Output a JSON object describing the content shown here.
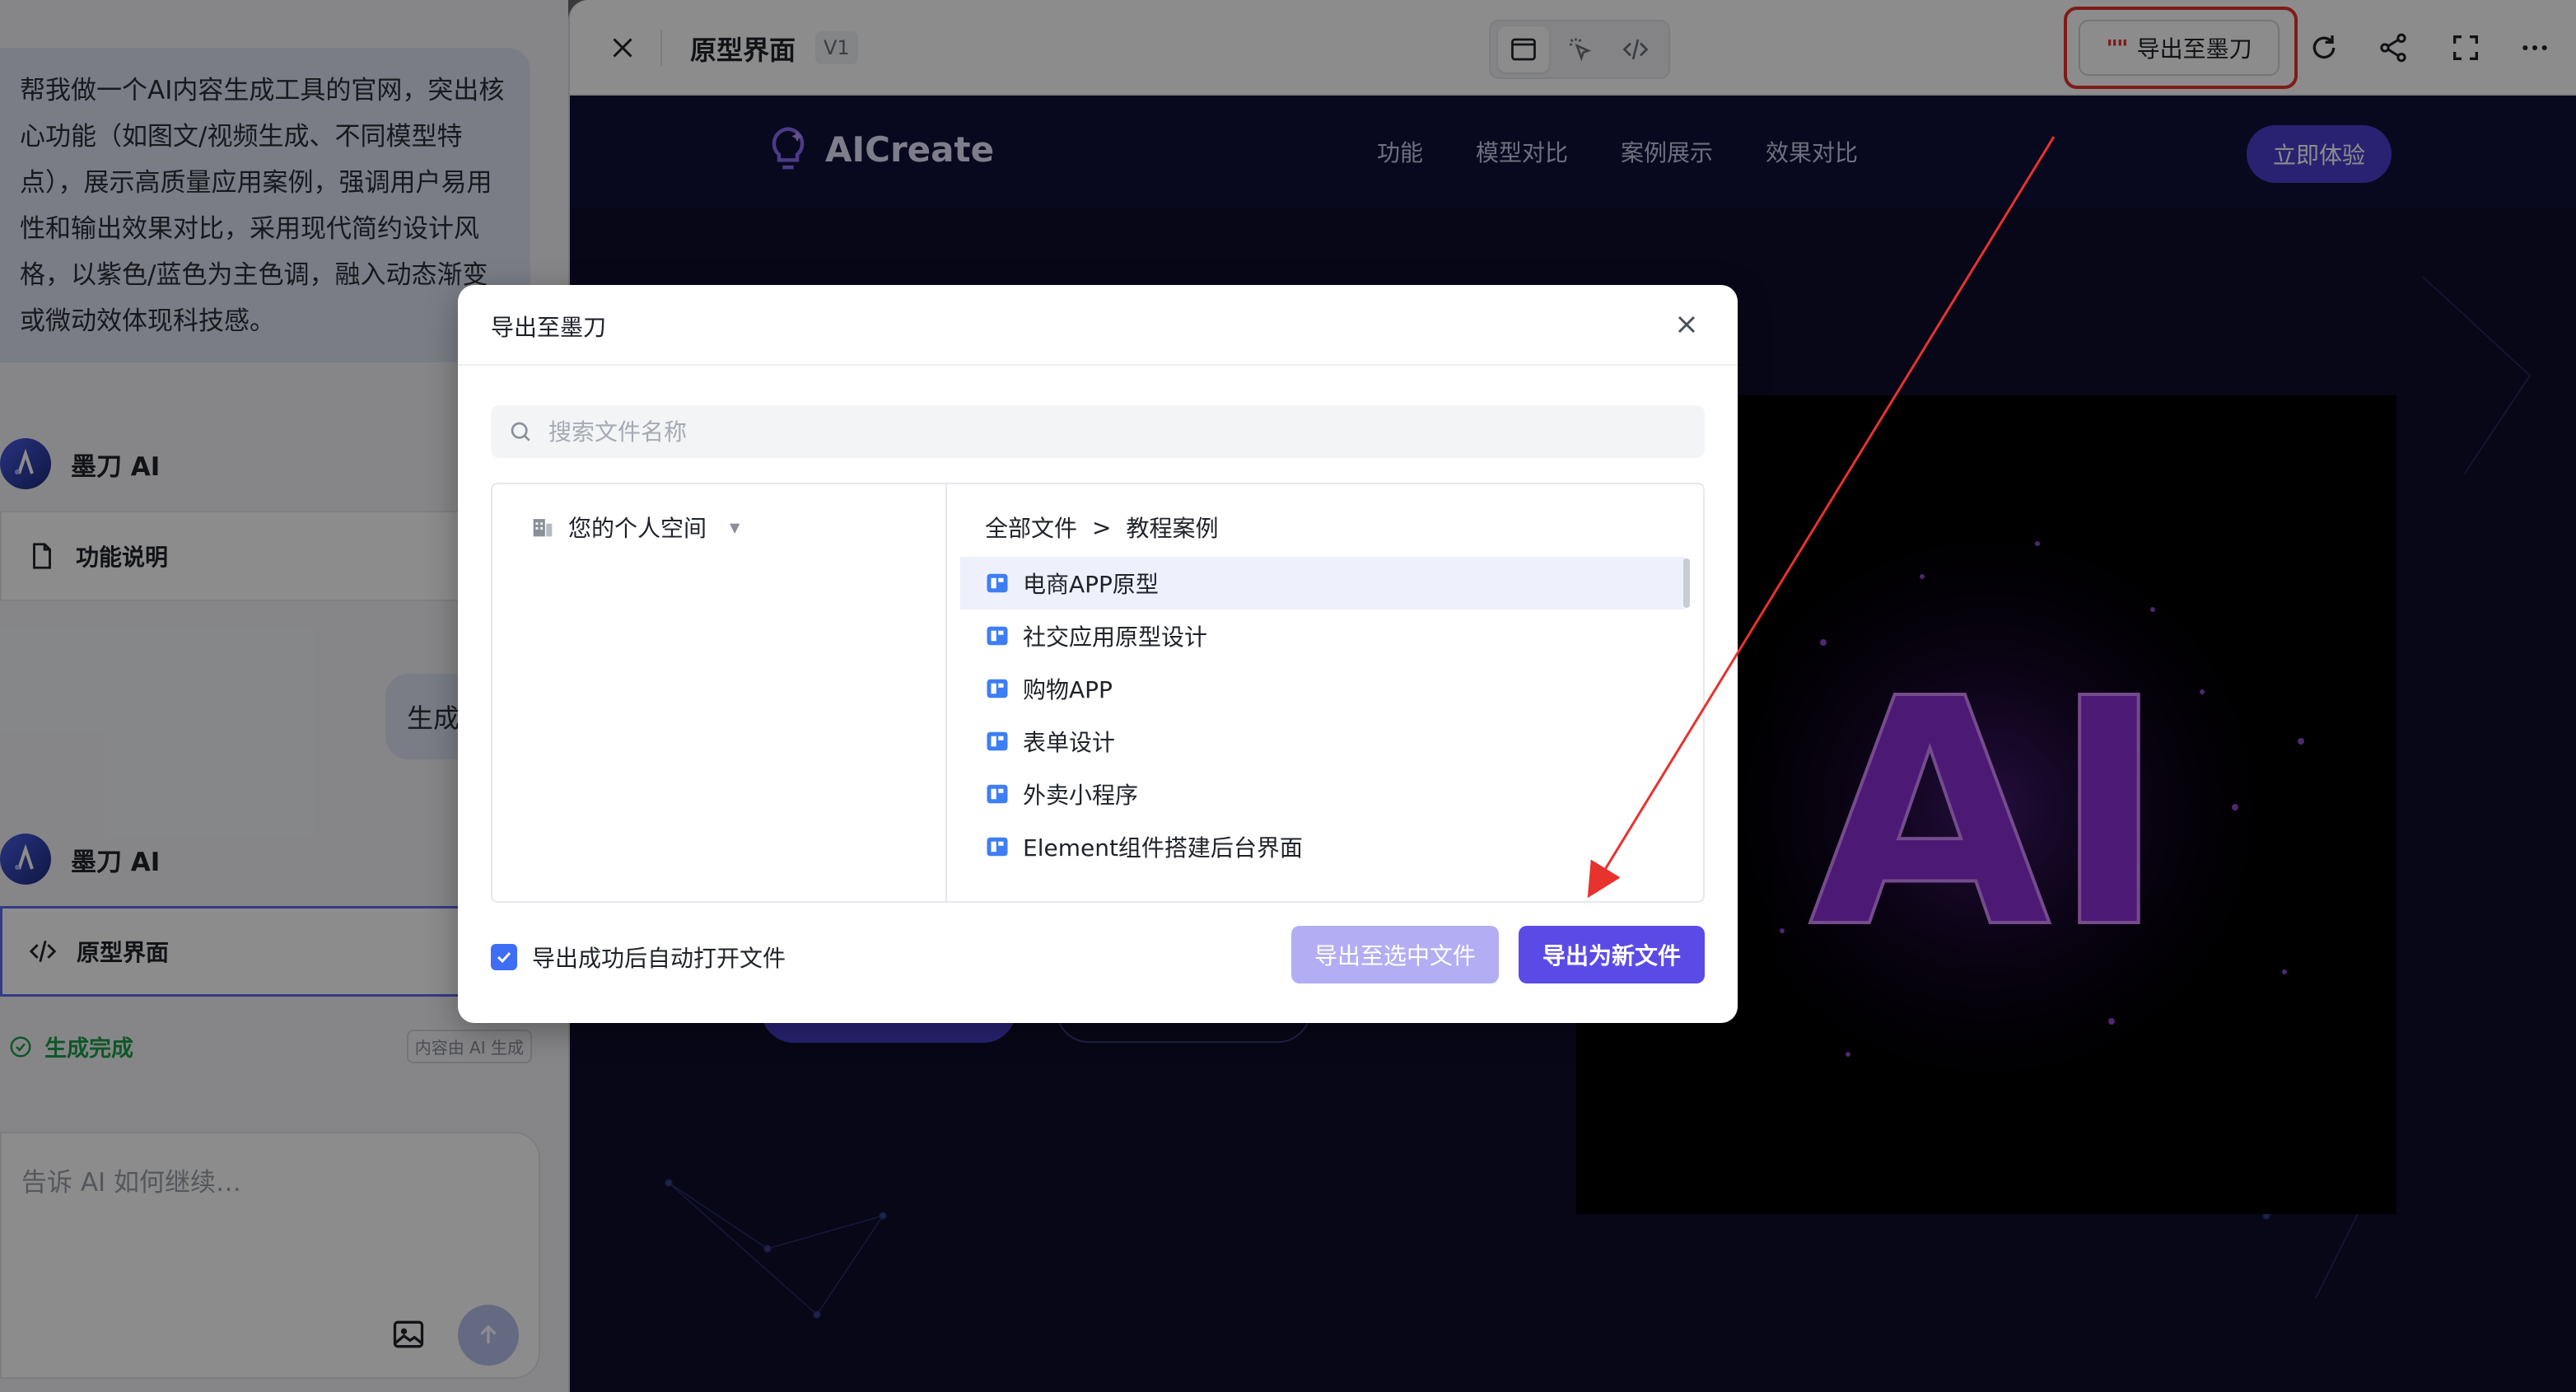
{
  "chat": {
    "user_prompt": "帮我做一个AI内容生成工具的官网，突出核心功能（如图文/视频生成、不同模型特点），展示高质量应用案例，强调用户易用性和输出效果对比，采用现代简约设计风格，以紫色/蓝色为主色调，融入动态渐变或微动效体现科技感。",
    "ai_name_1": "墨刀 AI",
    "card_1": "功能说明",
    "user_short": "生成",
    "ai_name_2": "墨刀 AI",
    "card_2": "原型界面",
    "status": "生成完成",
    "status_tag": "内容由 AI 生成",
    "input_placeholder": "告诉 AI 如何继续…"
  },
  "toolbar": {
    "title": "原型界面",
    "version": "V1",
    "export_label": "导出至墨刀",
    "export_logo": "\"\""
  },
  "site": {
    "brand": "AICreate",
    "links": [
      "功能",
      "模型对比",
      "案例展示",
      "效果对比"
    ],
    "cta": "立即体验",
    "hero_image_text": "AI"
  },
  "modal": {
    "title": "导出至墨刀",
    "search_placeholder": "搜索文件名称",
    "space_label": "您的个人空间",
    "breadcrumb_root": "全部文件",
    "breadcrumb_sep": ">",
    "breadcrumb_current": "教程案例",
    "files": [
      "电商APP原型",
      "社交应用原型设计",
      "购物APP",
      "表单设计",
      "外卖小程序",
      "Element组件搭建后台界面"
    ],
    "auto_open_label": "导出成功后自动打开文件",
    "auto_open_checked": true,
    "btn_export_selected": "导出至选中文件",
    "btn_export_new": "导出为新文件"
  },
  "colors": {
    "accent": "#5b4be6",
    "highlight": "#e8322e",
    "success": "#1c9e4b"
  }
}
